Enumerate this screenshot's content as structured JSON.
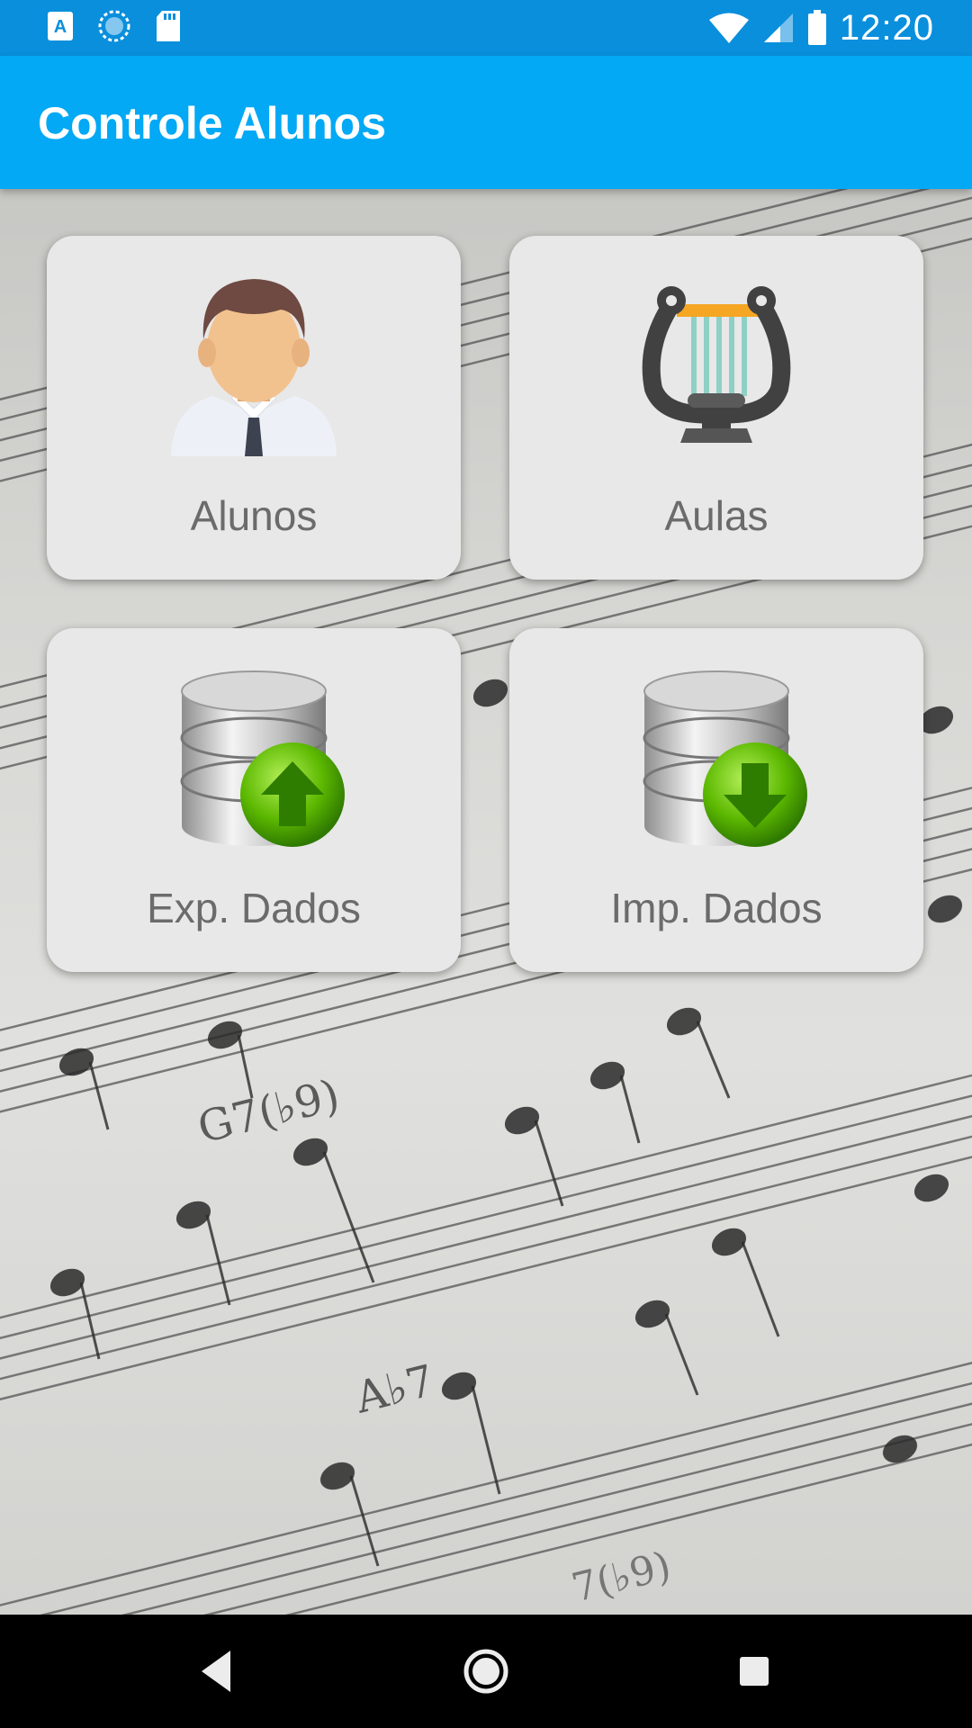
{
  "status_bar": {
    "time": "12:20",
    "icons": [
      "font-a-icon",
      "sync-icon",
      "sd-card-icon",
      "wifi-icon",
      "signal-icon",
      "battery-icon"
    ]
  },
  "app_bar": {
    "title": "Controle Alunos"
  },
  "cards": [
    {
      "label": "Alunos",
      "icon": "student-icon"
    },
    {
      "label": "Aulas",
      "icon": "lyre-icon"
    },
    {
      "label": "Exp. Dados",
      "icon": "database-upload-icon"
    },
    {
      "label": "Imp. Dados",
      "icon": "database-download-icon"
    }
  ],
  "background_chords": [
    "G7(♭9)",
    "A♭7",
    "7(♭9)"
  ],
  "colors": {
    "status_bar": "#0a8fdc",
    "app_bar": "#03a9f4",
    "card": "#e8e8e8",
    "label": "#6b6b6b",
    "green_arrow": "#55b800"
  },
  "nav_bar": {
    "buttons": [
      "back-icon",
      "home-icon",
      "recents-icon"
    ]
  }
}
